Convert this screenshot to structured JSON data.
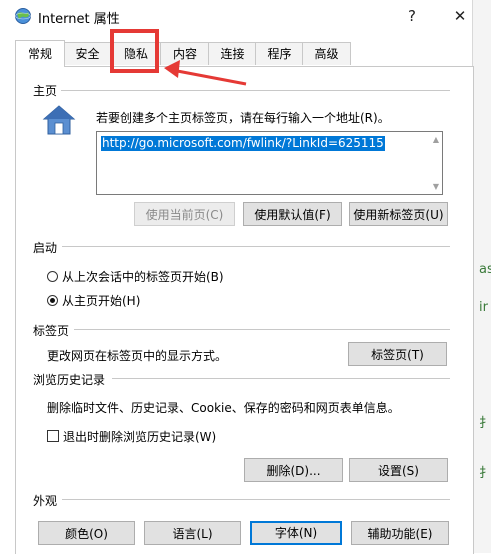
{
  "window": {
    "title": "Internet 属性",
    "help": "?",
    "close": "✕"
  },
  "tabs": [
    "常规",
    "安全",
    "隐私",
    "内容",
    "连接",
    "程序",
    "高级"
  ],
  "homepage": {
    "group": "主页",
    "desc": "若要创建多个主页标签页，请在每行输入一个地址(R)。",
    "url": "http://go.microsoft.com/fwlink/?LinkId=625115",
    "btn_current": "使用当前页(C)",
    "btn_default": "使用默认值(F)",
    "btn_newtab": "使用新标签页(U)"
  },
  "startup": {
    "group": "启动",
    "opt1": "从上次会话中的标签页开始(B)",
    "opt2": "从主页开始(H)",
    "selected": 2
  },
  "tabsgroup": {
    "group": "标签页",
    "desc": "更改网页在标签页中的显示方式。",
    "btn": "标签页(T)"
  },
  "history": {
    "group": "浏览历史记录",
    "desc": "删除临时文件、历史记录、Cookie、保存的密码和网页表单信息。",
    "checkbox": "退出时删除浏览历史记录(W)",
    "btn_delete": "删除(D)...",
    "btn_settings": "设置(S)"
  },
  "appearance": {
    "group": "外观",
    "btn_colors": "颜色(O)",
    "btn_languages": "语言(L)",
    "btn_fonts": "字体(N)",
    "btn_accessibility": "辅助功能(E)"
  },
  "side_fragments": [
    "as",
    "ir",
    "扌",
    "扌"
  ],
  "colors": {
    "accent": "#0078d7",
    "annotation": "#e53935"
  }
}
